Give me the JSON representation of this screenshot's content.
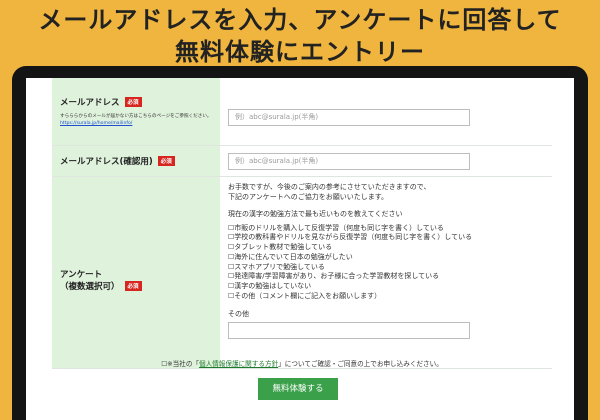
{
  "headline": {
    "line1": "メールアドレスを入力、アンケートに回答して",
    "line2": "無料体験にエントリー"
  },
  "form": {
    "email": {
      "label": "メールアドレス",
      "required": "必須",
      "note": "すらららからのメールが届かない方はこちらのページをご参照ください。",
      "note_link": "https://surala.jp/home/mailinfo/",
      "placeholder": "例）abc@surala.jp(半角)"
    },
    "email_confirm": {
      "label": "メールアドレス(確認用)",
      "required": "必須",
      "placeholder": "例）abc@surala.jp(半角)"
    },
    "survey": {
      "label_line1": "アンケート",
      "label_line2": "（複数選択可）",
      "required": "必須",
      "intro_line1": "お手数ですが、今後のご案内の参考にさせていただきますので、",
      "intro_line2": "下記のアンケートへのご協力をお願いいたします。",
      "question": "現在の漢字の勉強方法で最も近いものを教えてください",
      "options": [
        "☐市販のドリルを購入して反復学習（何度も同じ字を書く）している",
        "☐学校の教科書やドリルを見ながら反復学習（何度も同じ字を書く）している",
        "☐タブレット教材で勉強している",
        "☐海外に住んでいて日本の勉強がしたい",
        "☐スマホアプリで勉強している",
        "☐発達障害/学習障害があり、お子様に合った学習教材を探している",
        "☐漢字の勉強はしていない",
        "☐その他（コメント欄にご記入をお願いします）"
      ],
      "other_label": "その他"
    },
    "consent": {
      "prefix": "☐※当社の「",
      "link": "個人情報保護に関する方針",
      "suffix": "」についてご確認・ご同意の上でお申し込みください。"
    },
    "submit_label": "無料体験する"
  },
  "colors": {
    "background": "#efb53f",
    "label_bg": "#dff2dc",
    "required_badge": "#d7261f",
    "submit_button": "#3aa04a"
  }
}
